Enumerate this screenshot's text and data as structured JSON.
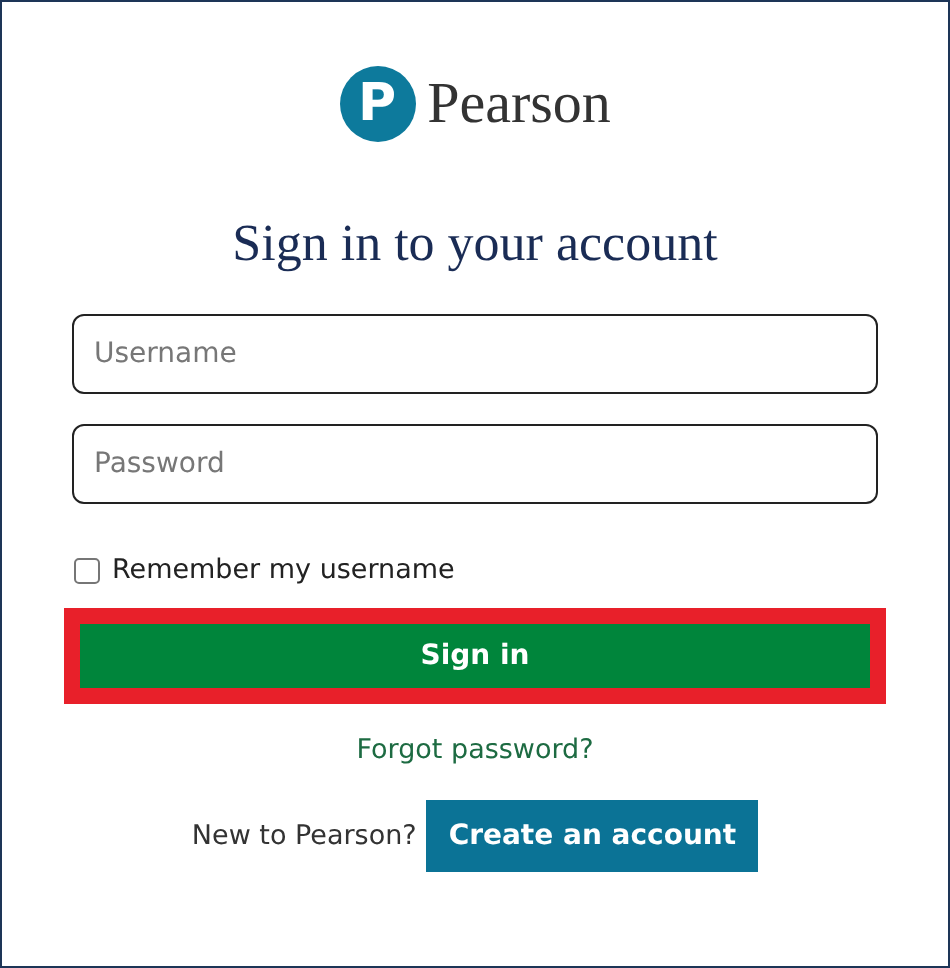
{
  "logo": {
    "mark": "P",
    "wordmark": "Pearson"
  },
  "title": "Sign in to your account",
  "fields": [
    {
      "placeholder": "Username"
    },
    {
      "placeholder": "Password"
    }
  ],
  "remember": {
    "label": "Remember my username",
    "checked": false
  },
  "sign_in": {
    "label": "Sign in",
    "highlighted": true
  },
  "forgot_link": "Forgot password?",
  "signup": {
    "prompt": "New to Pearson?",
    "button": "Create an account"
  }
}
